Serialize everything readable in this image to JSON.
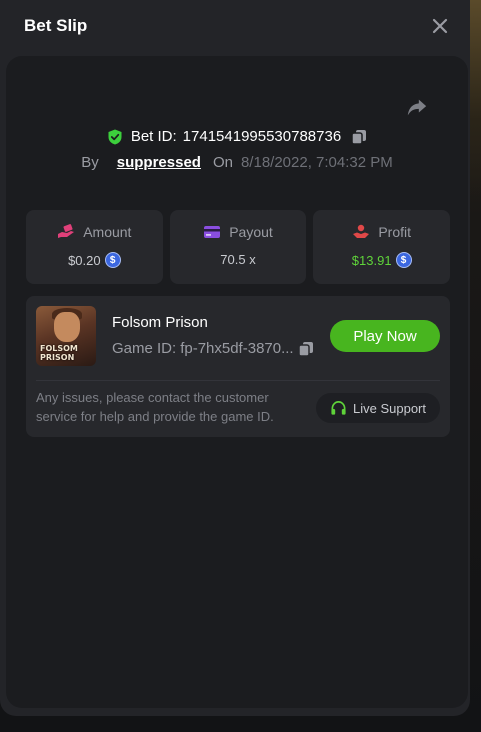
{
  "header": {
    "title": "Bet Slip",
    "close_icon": "close-icon"
  },
  "bet": {
    "share_icon": "share-icon",
    "shield_icon": "shield-check-icon",
    "id_label": "Bet ID:",
    "id_value": "1741541995530788736",
    "copy_icon": "copy-icon",
    "by_label": "By",
    "user": "suppressed",
    "on_label": "On",
    "date": "8/18/2022, 7:04:32 PM"
  },
  "stats": [
    {
      "label": "Amount",
      "value": "$0.20",
      "icon": "hand-money-icon",
      "coin": true,
      "color": "#e0407a"
    },
    {
      "label": "Payout",
      "value": "70.5 x",
      "icon": "card-icon",
      "coin": false,
      "color": "#8a4ee0"
    },
    {
      "label": "Profit",
      "value": "$13.91",
      "icon": "profit-hand-icon",
      "coin": true,
      "color": "#e04848"
    }
  ],
  "game": {
    "name": "Folsom Prison",
    "id_label": "Game ID:",
    "id_value": "fp-7hx5df-3870...",
    "thumb_text_1": "FOLSOM",
    "thumb_text_2": "PRISON",
    "play_label": "Play Now",
    "help_text": "Any issues, please contact the customer service for help and provide the game ID.",
    "live_support_label": "Live Support"
  },
  "colors": {
    "accent_green": "#48b51f",
    "profit_green": "#5fd33a",
    "shield_green": "#3ccf3c",
    "coin_blue": "#3b67e0"
  }
}
